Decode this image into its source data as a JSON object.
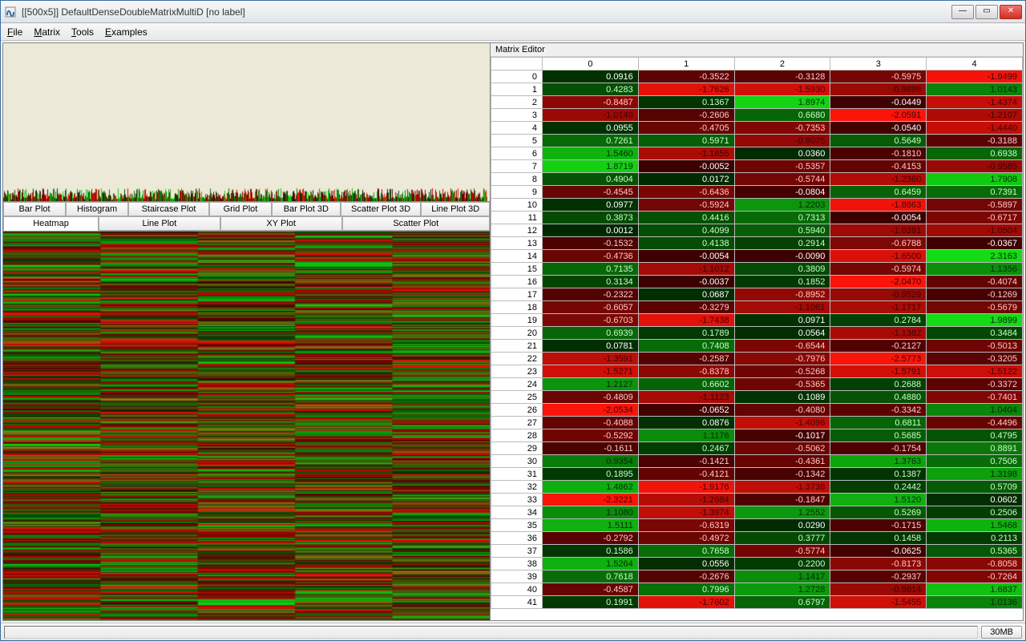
{
  "window": {
    "title": "[[500x5]] DefaultDenseDoubleMatrixMultiD [no label]"
  },
  "menu": {
    "file": "File",
    "matrix": "Matrix",
    "tools": "Tools",
    "examples": "Examples"
  },
  "tabs_row1": {
    "bar": "Bar Plot",
    "hist": "Histogram",
    "stair": "Staircase Plot",
    "grid": "Grid Plot",
    "bar3d": "Bar Plot 3D",
    "scatter3d": "Scatter Plot 3D",
    "line3d": "Line Plot 3D"
  },
  "tabs_row2": {
    "heatmap": "Heatmap",
    "line": "Line Plot",
    "xy": "XY Plot",
    "scatter": "Scatter Plot"
  },
  "editor": {
    "title": "Matrix Editor"
  },
  "status": {
    "memory": "30MB"
  },
  "chart_data": {
    "type": "heatmap",
    "title": "",
    "columns": [
      "0",
      "1",
      "2",
      "3",
      "4"
    ],
    "rows_shown": 42,
    "values": [
      [
        0.0916,
        -0.3522,
        -0.3128,
        -0.5975,
        -1.9499
      ],
      [
        0.4283,
        -1.7626,
        -1.593,
        -0.9899,
        1.0143
      ],
      [
        -0.8487,
        0.1367,
        1.8974,
        -0.0449,
        -1.4374
      ],
      [
        -1.014,
        -0.2606,
        0.668,
        -2.0591,
        -1.2107
      ],
      [
        0.0955,
        -0.4705,
        -0.7353,
        -0.054,
        -1.444
      ],
      [
        0.7261,
        0.5971,
        -0.9075,
        0.5649,
        -0.3188
      ],
      [
        1.546,
        -1.1655,
        0.036,
        -0.181,
        0.6938
      ],
      [
        1.8719,
        -0.0052,
        -0.5357,
        -0.4153,
        -0.9585
      ],
      [
        0.4904,
        0.0172,
        -0.5744,
        -1.236,
        1.7908
      ],
      [
        -0.4545,
        -0.6436,
        -0.0804,
        0.6459,
        0.7391
      ],
      [
        0.0977,
        -0.5924,
        1.2203,
        -1.8863,
        -0.5897
      ],
      [
        0.3873,
        0.4416,
        0.7313,
        -0.0054,
        -0.6717
      ],
      [
        0.0012,
        0.4099,
        0.594,
        -1.0281,
        -1.0504
      ],
      [
        -0.1532,
        0.4138,
        0.2914,
        -0.6788,
        -0.0367
      ],
      [
        -0.4736,
        -0.0054,
        -0.009,
        -1.65,
        2.3163
      ],
      [
        0.7135,
        -1.1012,
        0.3809,
        -0.5974,
        1.1356
      ],
      [
        0.3134,
        -0.0037,
        0.1852,
        -2.047,
        -0.4074
      ],
      [
        -0.2322,
        0.0687,
        -0.8952,
        -0.9529,
        -0.1269
      ],
      [
        -0.6057,
        -0.3279,
        -1.1061,
        -1.1717,
        -0.5679
      ],
      [
        -0.6703,
        -1.7438,
        0.0971,
        0.2784,
        1.9899
      ],
      [
        0.6939,
        0.1789,
        0.0564,
        -1.1382,
        0.3484
      ],
      [
        0.0781,
        0.7408,
        -0.6544,
        -0.2127,
        -0.5013
      ],
      [
        -1.3591,
        -0.2587,
        -0.7976,
        -2.5773,
        -0.3205
      ],
      [
        -1.5271,
        -0.8378,
        -0.5268,
        -1.5791,
        -1.5122
      ],
      [
        1.2127,
        0.6602,
        -0.5365,
        0.2688,
        -0.3372
      ],
      [
        -0.4809,
        -1.1123,
        0.1089,
        0.488,
        -0.7401
      ],
      [
        -2.0534,
        -0.0652,
        -0.408,
        -0.3342,
        1.0404
      ],
      [
        -0.4088,
        0.0876,
        -1.4096,
        0.6811,
        -0.4496
      ],
      [
        -0.5292,
        1.1176,
        -0.1017,
        0.5685,
        0.4795
      ],
      [
        -0.1611,
        0.2467,
        -0.5062,
        -0.1754,
        0.8891
      ],
      [
        0.9354,
        -0.1421,
        -0.4361,
        1.3763,
        0.7506
      ],
      [
        0.1895,
        -0.4121,
        -0.1342,
        0.1387,
        1.3198
      ],
      [
        1.4862,
        -1.9176,
        -1.3738,
        0.2442,
        0.5709
      ],
      [
        -2.3221,
        -1.2684,
        -0.1847,
        1.512,
        0.0602
      ],
      [
        1.108,
        -1.3974,
        1.2552,
        0.5269,
        0.2506
      ],
      [
        1.5111,
        -0.6319,
        0.029,
        -0.1715,
        1.5468
      ],
      [
        -0.2792,
        -0.4972,
        0.3777,
        0.1458,
        0.2113
      ],
      [
        0.1586,
        0.7658,
        -0.5774,
        -0.0625,
        0.5365
      ],
      [
        1.5264,
        0.0556,
        0.22,
        -0.8173,
        -0.8058
      ],
      [
        0.7618,
        -0.2676,
        1.1417,
        -0.2937,
        -0.7264
      ],
      [
        -0.4587,
        0.7996,
        1.2728,
        -0.9814,
        1.6837
      ],
      [
        0.1991,
        -1.7602,
        0.6797,
        -1.5455,
        1.0136
      ]
    ]
  }
}
